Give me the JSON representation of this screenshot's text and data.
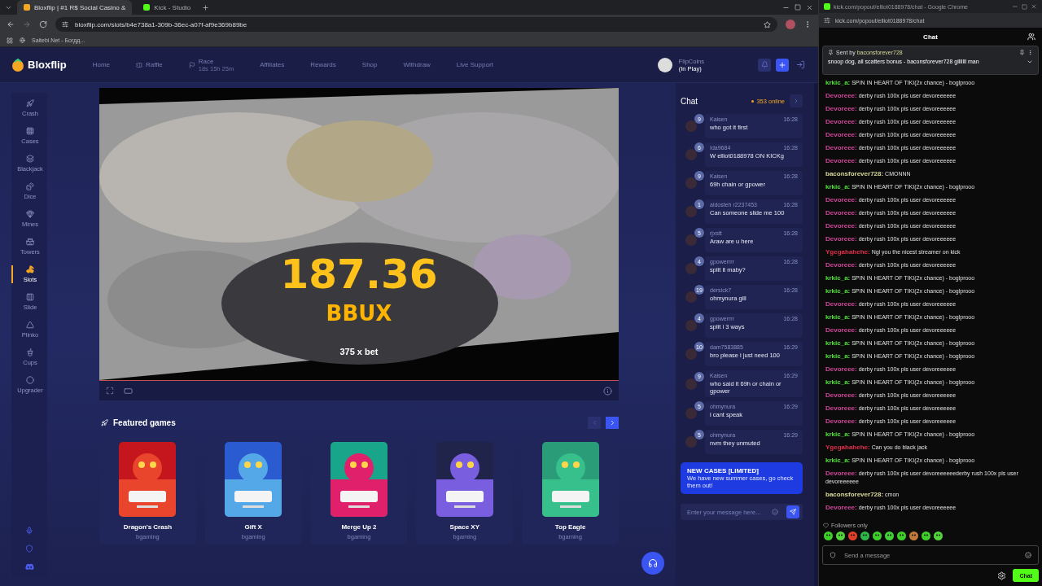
{
  "browser": {
    "tabs": [
      {
        "title": "Bloxflip | #1 R$ Social Casino &",
        "selected": true
      },
      {
        "title": "Kick - Studio",
        "selected": false
      }
    ],
    "url": "bloxflip.com/slots/b4e738a1-309b-36ec-a07f-af9e369b89be",
    "bookmarks": [
      "Saitebi.Net - Богдд..."
    ]
  },
  "site_nav": {
    "logo": "Bloxflip",
    "items": [
      {
        "label": "Home"
      },
      {
        "label": "Raffle"
      },
      {
        "label": "Race",
        "sub": "18s 15h 25m"
      },
      {
        "label": "Affiliates"
      },
      {
        "label": "Rewards"
      },
      {
        "label": "Shop"
      },
      {
        "label": "Withdraw"
      },
      {
        "label": "Live Support"
      }
    ],
    "user": {
      "name": "FlipCoins",
      "status": "(In Play)"
    }
  },
  "sidebar": {
    "items": [
      {
        "label": "Crash",
        "selected": false
      },
      {
        "label": "Cases",
        "selected": false
      },
      {
        "label": "Blackjack",
        "selected": false
      },
      {
        "label": "Dice",
        "selected": false
      },
      {
        "label": "Mines",
        "selected": false
      },
      {
        "label": "Towers",
        "selected": false
      },
      {
        "label": "Slots",
        "selected": true
      },
      {
        "label": "Slide",
        "selected": false
      },
      {
        "label": "Plinko",
        "selected": false
      },
      {
        "label": "Cups",
        "selected": false
      },
      {
        "label": "Upgrader",
        "selected": false
      }
    ]
  },
  "game": {
    "win_amount": "187.36",
    "currency": "BBUX",
    "multiplier": "375 x bet"
  },
  "featured": {
    "title": "Featured games",
    "games": [
      {
        "name": "Dragon's Crash",
        "provider": "bgaming"
      },
      {
        "name": "Gift X",
        "provider": "bgaming"
      },
      {
        "name": "Merge Up 2",
        "provider": "bgaming"
      },
      {
        "name": "Space XY",
        "provider": "bgaming"
      },
      {
        "name": "Top Eagle",
        "provider": "bgaming"
      }
    ]
  },
  "site_chat": {
    "title": "Chat",
    "online": "353 online",
    "messages": [
      {
        "user": "Kaisen",
        "level": "9",
        "time": "16:28",
        "text": "who got it first"
      },
      {
        "user": "Ida9684",
        "level": "6",
        "time": "16:28",
        "text": "W elliot0188978 ON KICKg"
      },
      {
        "user": "Kaisen",
        "level": "9",
        "time": "16:28",
        "text": "69h chain or gpower"
      },
      {
        "user": "aldosteh r2237453",
        "level": "1",
        "time": "16:28",
        "text": "Can someone slide me 100"
      },
      {
        "user": "rjxstt",
        "level": "5",
        "time": "16:28",
        "text": "Araw are u here"
      },
      {
        "user": "gpowerrrr",
        "level": "4",
        "time": "16:28",
        "text": "split it maby?"
      },
      {
        "user": "dersick7",
        "level": "19",
        "time": "16:28",
        "text": "ohmynura gill"
      },
      {
        "user": "gpowerrrr",
        "level": "4",
        "time": "16:28",
        "text": "split i 3 ways"
      },
      {
        "user": "dam7583885",
        "level": "10",
        "time": "16:29",
        "text": "bro please i just need 100"
      },
      {
        "user": "Kaisen",
        "level": "9",
        "time": "16:29",
        "text": "who said it 69h or chain or gpower"
      },
      {
        "user": "ohmynura",
        "level": "5",
        "time": "16:29",
        "text": "i cant speak"
      },
      {
        "user": "ohmynura",
        "level": "5",
        "time": "16:29",
        "text": "nvm they unmuted"
      }
    ],
    "promo": {
      "title": "NEW CASES [LIMITED]",
      "text": "We have new summer cases, go check them out!"
    },
    "input": {
      "placeholder": "Enter your message here..."
    }
  },
  "kick": {
    "window_title": "kick.com/popout/elliot0188978/chat - Google Chrome",
    "url": "kick.com/popout/elliot0188978/chat",
    "title": "Chat",
    "pinned": {
      "label": "Sent by",
      "user": "baconsforever728",
      "text": "snoop dog, all scatters bonus - baconsforever728 glllllll man"
    },
    "messages": [
      {
        "user": "krkic_a:",
        "color": "#53e03c",
        "text": "SPIN IN HEART OF TIKI(2x chance) - boglprooo"
      },
      {
        "user": "Devoreee:",
        "color": "#d0489a",
        "text": "derby rush 100x pls user devoreeeeee"
      },
      {
        "user": "Devoreee:",
        "color": "#d0489a",
        "text": "derby rush 100x pls user devoreeeeee"
      },
      {
        "user": "Devoreee:",
        "color": "#d0489a",
        "text": "derby rush 100x pls user devoreeeeee"
      },
      {
        "user": "Devoreee:",
        "color": "#d0489a",
        "text": "derby rush 100x pls user devoreeeeee"
      },
      {
        "user": "Devoreee:",
        "color": "#d0489a",
        "text": "derby rush 100x pls user devoreeeeee"
      },
      {
        "user": "Devoreee:",
        "color": "#d0489a",
        "text": "derby rush 100x pls user devoreeeeee"
      },
      {
        "user": "baconsforever728:",
        "color": "#d8d89c",
        "text": "CMONNN"
      },
      {
        "user": "krkic_a:",
        "color": "#53e03c",
        "text": "SPIN IN HEART OF TIKI(2x chance) - boglprooo"
      },
      {
        "user": "Devoreee:",
        "color": "#d0489a",
        "text": "derby rush 100x pls user devoreeeeee"
      },
      {
        "user": "Devoreee:",
        "color": "#d0489a",
        "text": "derby rush 100x pls user devoreeeeee"
      },
      {
        "user": "Devoreee:",
        "color": "#d0489a",
        "text": "derby rush 100x pls user devoreeeeee"
      },
      {
        "user": "Devoreee:",
        "color": "#d0489a",
        "text": "derby rush 100x pls user devoreeeeee"
      },
      {
        "user": "Ygegahahehe:",
        "color": "#e2304c",
        "text": "Ngl you the nicest streamer on kick"
      },
      {
        "user": "Devoreee:",
        "color": "#d0489a",
        "text": "derby rush 100x pls user devoreeeeee"
      },
      {
        "user": "krkic_a:",
        "color": "#53e03c",
        "text": "SPIN IN HEART OF TIKI(2x chance) - boglprooo"
      },
      {
        "user": "krkic_a:",
        "color": "#53e03c",
        "text": "SPIN IN HEART OF TIKI(2x chance) - boglprooo"
      },
      {
        "user": "Devoreee:",
        "color": "#d0489a",
        "text": "derby rush 100x pls user devoreeeeee"
      },
      {
        "user": "krkic_a:",
        "color": "#53e03c",
        "text": "SPIN IN HEART OF TIKI(2x chance) - boglprooo"
      },
      {
        "user": "Devoreee:",
        "color": "#d0489a",
        "text": "derby rush 100x pls user devoreeeeee"
      },
      {
        "user": "krkic_a:",
        "color": "#53e03c",
        "text": "SPIN IN HEART OF TIKI(2x chance) - boglprooo"
      },
      {
        "user": "krkic_a:",
        "color": "#53e03c",
        "text": "SPIN IN HEART OF TIKI(2x chance) - boglprooo"
      },
      {
        "user": "Devoreee:",
        "color": "#d0489a",
        "text": "derby rush 100x pls user devoreeeeee"
      },
      {
        "user": "krkic_a:",
        "color": "#53e03c",
        "text": "SPIN IN HEART OF TIKI(2x chance) - boglprooo"
      },
      {
        "user": "Devoreee:",
        "color": "#d0489a",
        "text": "derby rush 100x pls user devoreeeeee"
      },
      {
        "user": "Devoreee:",
        "color": "#d0489a",
        "text": "derby rush 100x pls user devoreeeeee"
      },
      {
        "user": "Devoreee:",
        "color": "#d0489a",
        "text": "derby rush 100x pls user devoreeeeee"
      },
      {
        "user": "krkic_a:",
        "color": "#53e03c",
        "text": "SPIN IN HEART OF TIKI(2x chance) - boglprooo"
      },
      {
        "user": "Ygegahahehe:",
        "color": "#e2304c",
        "text": "Can you do black jack"
      },
      {
        "user": "krkic_a:",
        "color": "#53e03c",
        "text": "SPIN IN HEART OF TIKI(2x chance) - boglprooo"
      },
      {
        "user": "Devoreee:",
        "color": "#d0489a",
        "text": "derby rush 100x pls user devoreeeeeederby rush 100x pls user devoreeeeee"
      },
      {
        "user": "baconsforever728:",
        "color": "#d8d89c",
        "text": "cmon"
      },
      {
        "user": "Devoreee:",
        "color": "#d0489a",
        "text": "derby rush 100x pls user devoreeeeee"
      }
    ],
    "followers_only": "Followers only",
    "input": {
      "placeholder": "Send a message"
    },
    "send_button": "Chat"
  }
}
